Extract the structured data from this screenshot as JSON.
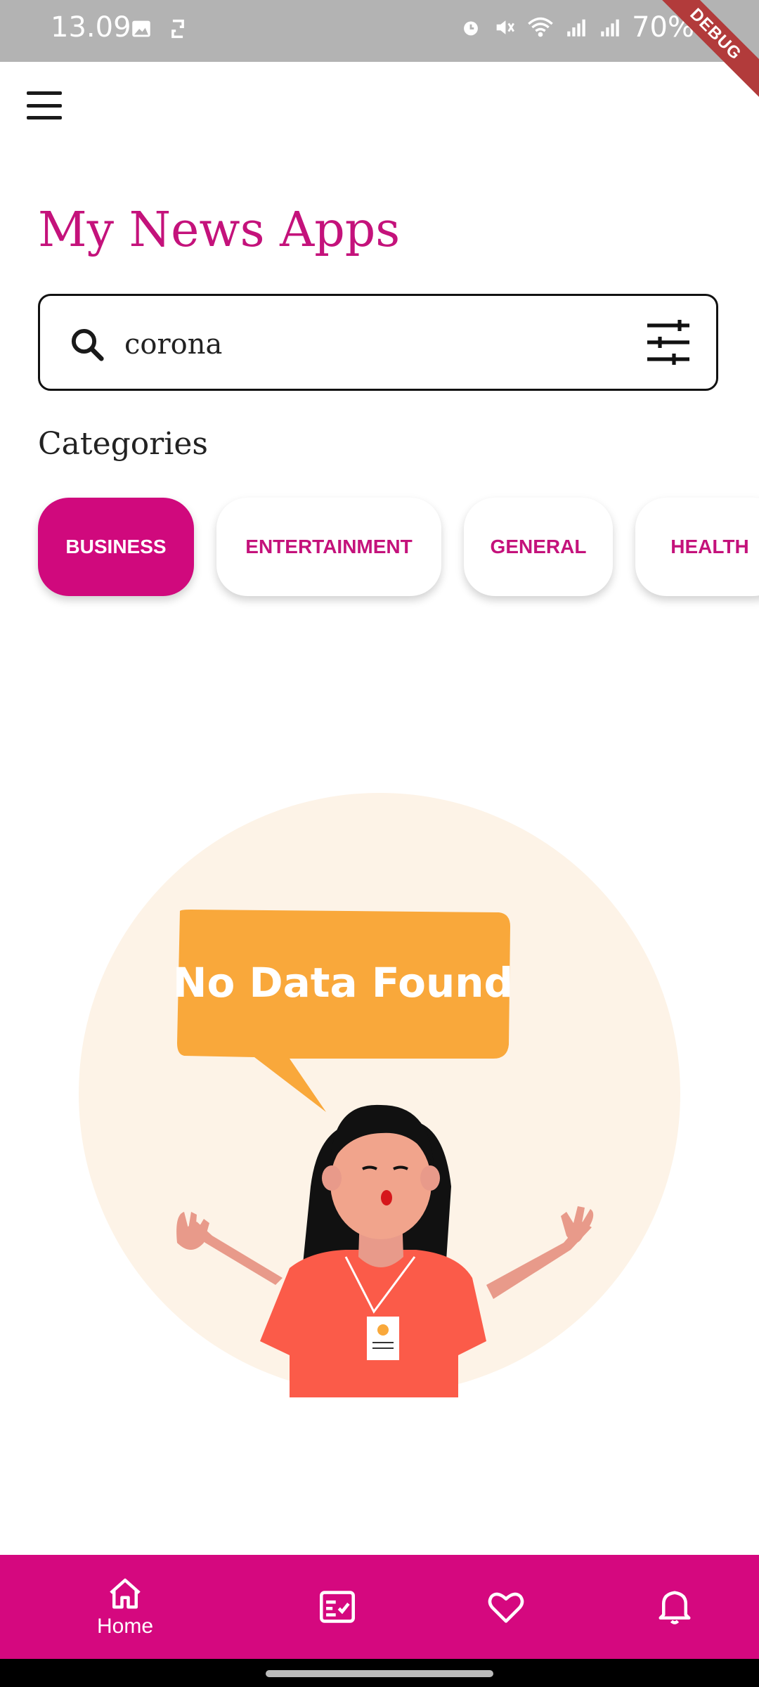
{
  "status_bar": {
    "time": "13.09",
    "battery": "70%",
    "left_icons": [
      "image-icon",
      "sync-icon"
    ],
    "right_icons": [
      "alarm-icon",
      "mute-icon",
      "wifi-icon",
      "signal-icon",
      "signal-icon",
      "battery-icon"
    ],
    "debug_label": "DEBUG"
  },
  "header": {
    "menu_icon": "hamburger-menu-icon",
    "title": "My News Apps"
  },
  "search": {
    "value": "corona",
    "placeholder": "",
    "icon": "search-icon",
    "filter_icon": "tune-icon"
  },
  "categories": {
    "label": "Categories",
    "items": [
      {
        "label": "BUSINESS",
        "active": true
      },
      {
        "label": "ENTERTAINMENT",
        "active": false
      },
      {
        "label": "GENERAL",
        "active": false
      },
      {
        "label": "HEALTH",
        "active": false
      }
    ]
  },
  "empty_state": {
    "message": "No Data Found"
  },
  "bottom_nav": {
    "items": [
      {
        "icon": "home-icon",
        "label": "Home"
      },
      {
        "icon": "checklist-icon",
        "label": ""
      },
      {
        "icon": "heart-icon",
        "label": ""
      },
      {
        "icon": "bell-icon",
        "label": ""
      }
    ]
  },
  "colors": {
    "accent": "#d0097d",
    "title": "#c4127b",
    "bubble": "#f9a83b",
    "circle": "#fdf3e7"
  }
}
